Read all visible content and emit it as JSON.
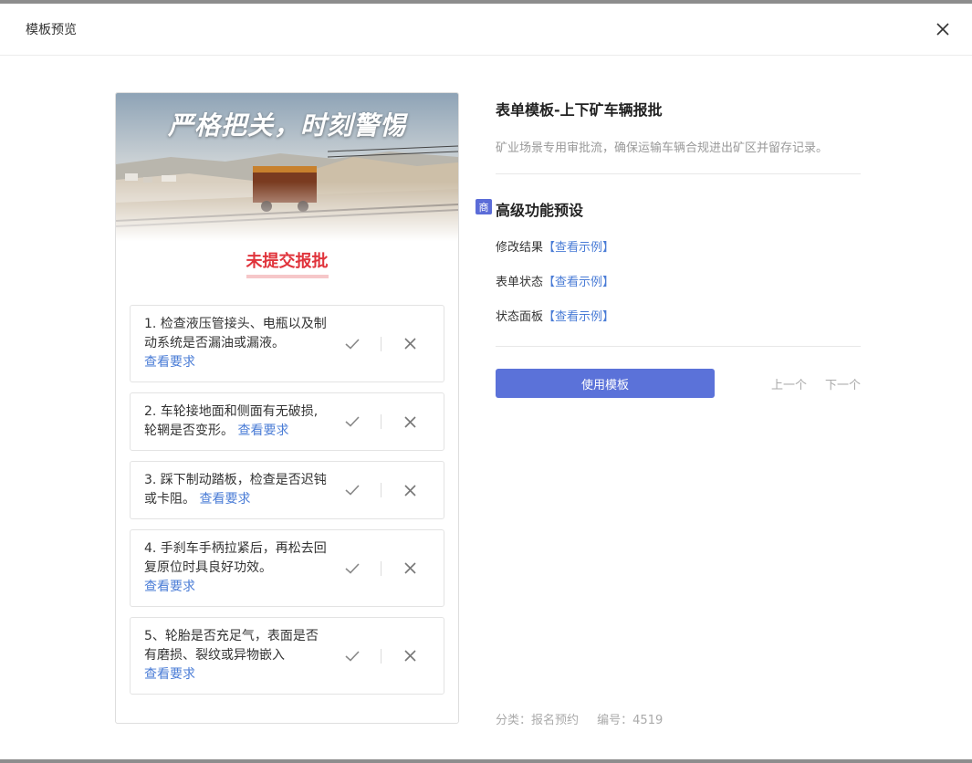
{
  "modal": {
    "title": "模板预览",
    "close_label": "X"
  },
  "preview": {
    "banner_text": "严格把关，时刻警惕",
    "status": "未提交报批",
    "items": [
      {
        "text": "1. 检查液压管接头、电瓶以及制动系统是否漏油或漏液。",
        "link": "查看要求"
      },
      {
        "text": "2. 车轮接地面和侧面有无破损,轮辋是否变形。",
        "link": "查看要求"
      },
      {
        "text": "3. 踩下制动踏板，检查是否迟钝或卡阻。",
        "link": "查看要求"
      },
      {
        "text": "4. 手刹车手柄拉紧后，再松去回复原位时具良好功效。",
        "link": "查看要求"
      },
      {
        "text": "5、轮胎是否充足气，表面是否有磨损、裂纹或异物嵌入",
        "link": "查看要求"
      }
    ]
  },
  "info": {
    "title": "表单模板-上下矿车辆报批",
    "description": "矿业场景专用审批流，确保运输车辆合规进出矿区并留存记录。",
    "section_badge": "商",
    "section_title": "高级功能预设",
    "features": [
      {
        "label": "修改结果",
        "link": "【查看示例】"
      },
      {
        "label": "表单状态",
        "link": "【查看示例】"
      },
      {
        "label": "状态面板",
        "link": "【查看示例】"
      }
    ],
    "use_button": "使用模板",
    "prev": "上一个",
    "next": "下一个",
    "category": "分类：报名预约",
    "number": "编号：4519"
  },
  "colors": {
    "accent": "#5b72d9",
    "link": "#4a7cd6",
    "status_red": "#e0343c"
  }
}
